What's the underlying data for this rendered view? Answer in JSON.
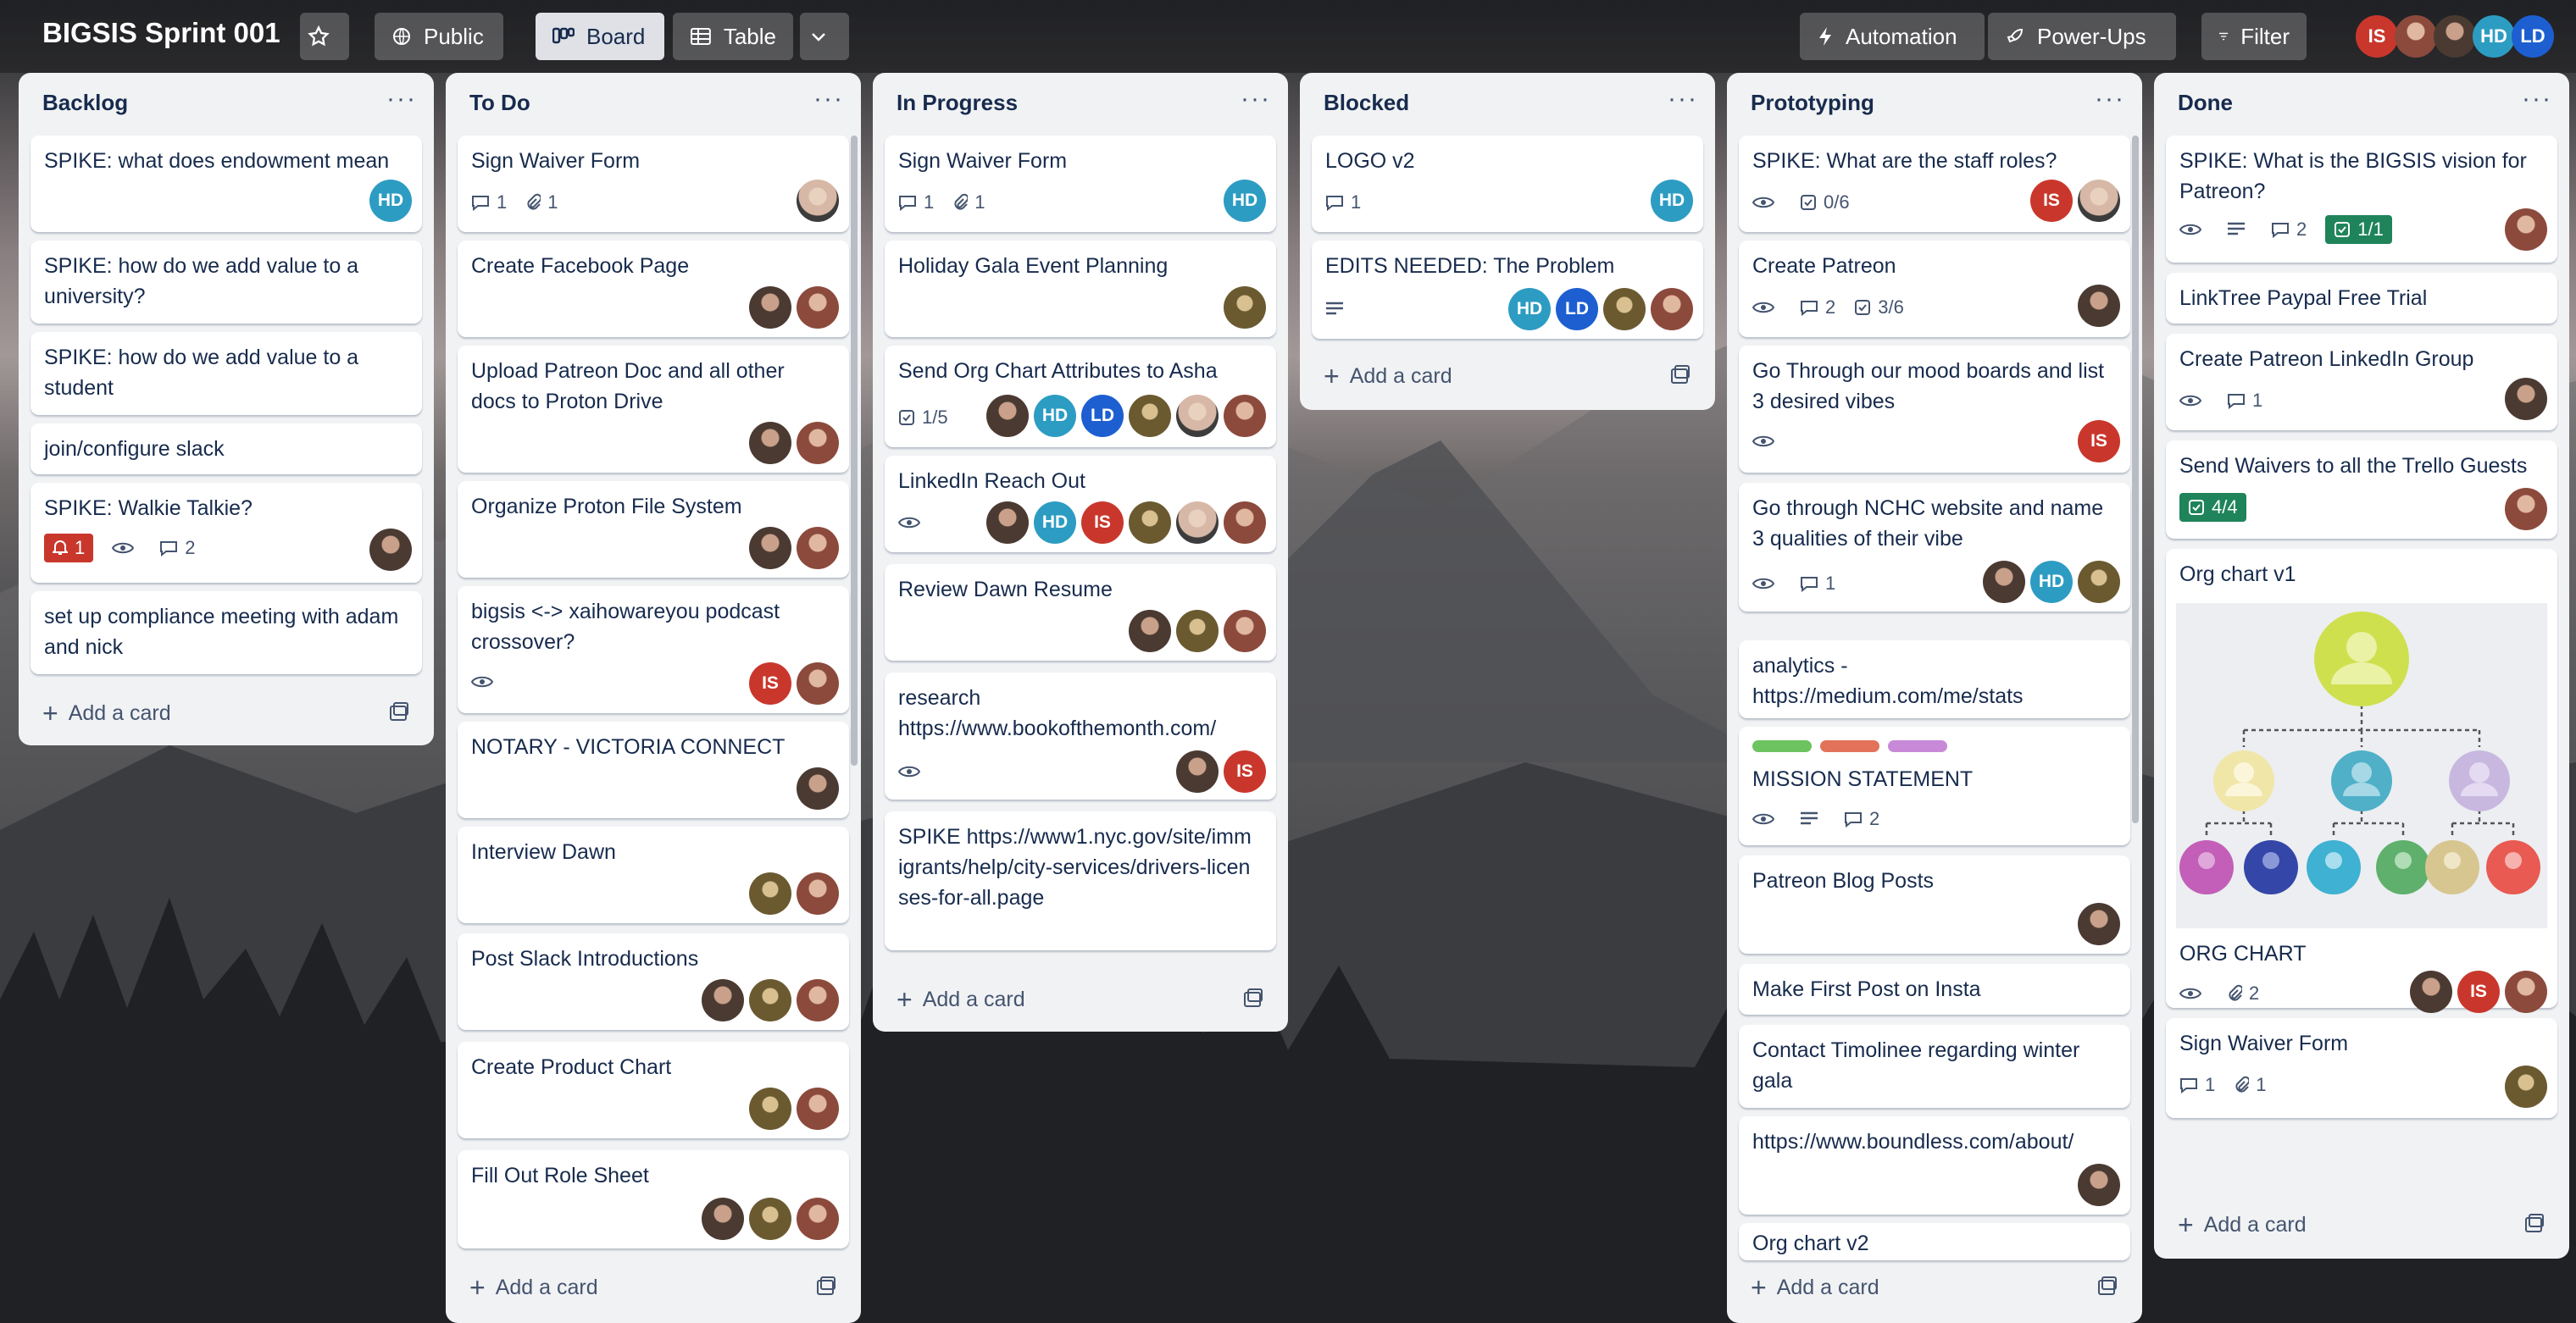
{
  "board": {
    "title": "BIGSIS Sprint 001",
    "visibility": "Public",
    "views": [
      "Board",
      "Table"
    ],
    "automation": "Automation",
    "powerups": "Power-Ups",
    "filter": "Filter"
  },
  "header_avatars": [
    "IS",
    "",
    "",
    "HD",
    "LD"
  ],
  "colors": {
    "is": "#c9372c",
    "hd": "#2d9cc2",
    "ld": "#1d5fd1",
    "green_badge": "#1f845a",
    "label_green": "#6cc35f",
    "label_red": "#e3725a",
    "label_purple": "#c88ad8"
  },
  "common": {
    "add_card": "Add a card"
  },
  "lists": [
    {
      "title": "Backlog",
      "cards": [
        {
          "title": "SPIKE: what does endowment mean",
          "members": [
            "HD"
          ]
        },
        {
          "title": "SPIKE: how do we add value to a university?"
        },
        {
          "title": "SPIKE: how do we add value to a student"
        },
        {
          "title": "join/configure slack"
        },
        {
          "title": "SPIKE: Walkie Talkie?",
          "due": "1",
          "comments": "2"
        },
        {
          "title": "set up compliance meeting with adam and nick"
        }
      ]
    },
    {
      "title": "To Do",
      "cards": [
        {
          "title": "Sign Waiver Form",
          "comments": "1",
          "attachments": "1"
        },
        {
          "title": "Create Facebook Page"
        },
        {
          "title": "Upload Patreon Doc and all other docs to Proton Drive"
        },
        {
          "title": "Organize Proton File System"
        },
        {
          "title": "bigsis <-> xaihowareyou podcast crossover?",
          "members": [
            "IS"
          ]
        },
        {
          "title": "NOTARY - VICTORIA CONNECT"
        },
        {
          "title": "Interview Dawn"
        },
        {
          "title": "Post Slack Introductions"
        },
        {
          "title": "Create Product Chart"
        },
        {
          "title": "Fill Out Role Sheet"
        }
      ]
    },
    {
      "title": "In Progress",
      "cards": [
        {
          "title": "Sign Waiver Form",
          "comments": "1",
          "attachments": "1",
          "members": [
            "HD"
          ]
        },
        {
          "title": "Holiday Gala Event Planning"
        },
        {
          "title": "Send Org Chart Attributes to Asha",
          "checklist": "1/5",
          "members": [
            "HD",
            "LD"
          ]
        },
        {
          "title": "LinkedIn Reach Out",
          "members": [
            "HD",
            "IS"
          ]
        },
        {
          "title": "Review Dawn Resume"
        },
        {
          "title": "research https://www.bookofthemonth.com/",
          "members": [
            "IS"
          ]
        },
        {
          "title": "SPIKE https://www1.nyc.gov/site/immigrants/help/city-services/drivers-licenses-for-all.page"
        }
      ]
    },
    {
      "title": "Blocked",
      "cards": [
        {
          "title": "LOGO v2",
          "comments": "1",
          "members": [
            "HD"
          ]
        },
        {
          "title": "EDITS NEEDED: The Problem",
          "members": [
            "HD",
            "LD"
          ]
        }
      ]
    },
    {
      "title": "Prototyping",
      "cards": [
        {
          "title": "SPIKE: What are the staff roles?",
          "checklist": "0/6",
          "members": [
            "IS"
          ]
        },
        {
          "title": "Create Patreon",
          "comments": "2",
          "checklist": "3/6"
        },
        {
          "title": "Go Through our mood boards and list 3 desired vibes",
          "members": [
            "IS"
          ]
        },
        {
          "title": "Go through NCHC website and name 3 qualities of their vibe",
          "comments": "1",
          "members": [
            "HD"
          ]
        },
        {
          "title": "analytics - https://medium.com/me/stats"
        },
        {
          "title": "MISSION STATEMENT",
          "comments": "2"
        },
        {
          "title": "Patreon Blog Posts"
        },
        {
          "title": "Make First Post on Insta"
        },
        {
          "title": "Contact Timolinee regarding winter gala"
        },
        {
          "title": "https://www.boundless.com/about/"
        },
        {
          "title": "Org chart v2"
        }
      ]
    },
    {
      "title": "Done",
      "cards": [
        {
          "title": "SPIKE: What is the BIGSIS vision for Patreon?",
          "comments": "2",
          "checklist": "1/1"
        },
        {
          "title": "LinkTree Paypal Free Trial"
        },
        {
          "title": "Create Patreon LinkedIn Group",
          "comments": "1"
        },
        {
          "title": "Send Waivers to all the Trello Guests",
          "checklist": "4/4"
        },
        {
          "title": "Org chart v1"
        },
        {
          "title": "ORG CHART",
          "attachments": "2",
          "members": [
            "IS"
          ]
        },
        {
          "title": "Sign Waiver Form",
          "comments": "1",
          "attachments": "1"
        }
      ]
    }
  ]
}
